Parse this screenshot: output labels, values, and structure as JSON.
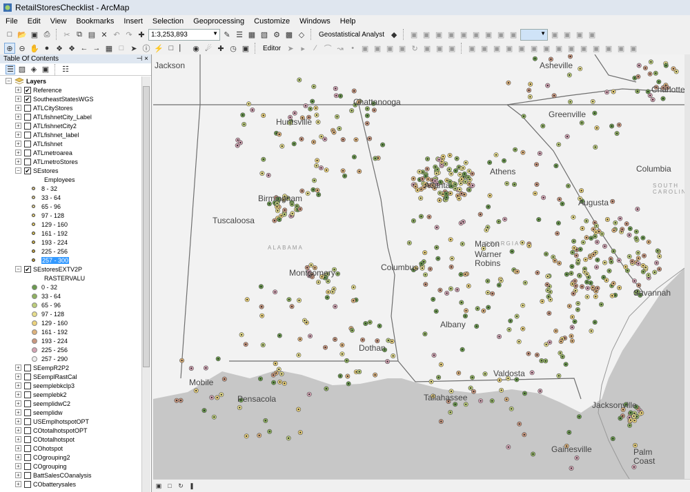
{
  "window": {
    "title": "RetailStoresChecklist - ArcMap"
  },
  "menu": [
    "File",
    "Edit",
    "View",
    "Bookmarks",
    "Insert",
    "Selection",
    "Geoprocessing",
    "Customize",
    "Windows",
    "Help"
  ],
  "toolbar": {
    "scale": "1:3,253,893",
    "geostat_label": "Geostatistical Analyst",
    "editor_label": "Editor"
  },
  "toc": {
    "title": "Table Of Contents",
    "pin": "⊣",
    "close": "×",
    "layers_label": "Layers",
    "layers": [
      {
        "name": "Reference",
        "checked": true
      },
      {
        "name": "SoutheastStatesWGS",
        "checked": true
      },
      {
        "name": "ATLCityStores",
        "checked": false
      },
      {
        "name": "ATLfishnetCity_Label",
        "checked": false
      },
      {
        "name": "ATLfishnetCity2",
        "checked": false
      },
      {
        "name": "ATLfishnet_label",
        "checked": false
      },
      {
        "name": "ATLfishnet",
        "checked": false
      },
      {
        "name": "ATLmetroarea",
        "checked": false
      },
      {
        "name": "ATLmetroStores",
        "checked": false
      }
    ],
    "sestores": {
      "name": "SEstores",
      "field": "Employees",
      "classes": [
        {
          "label": "8 - 32",
          "color": "#d8c38a"
        },
        {
          "label": "33 - 64",
          "color": "#dccb95"
        },
        {
          "label": "65 - 96",
          "color": "#e6d79a"
        },
        {
          "label": "97 - 128",
          "color": "#ecd683"
        },
        {
          "label": "129 - 160",
          "color": "#e9d06e"
        },
        {
          "label": "161 - 192",
          "color": "#d9c45c"
        },
        {
          "label": "193 - 224",
          "color": "#cdb24f"
        },
        {
          "label": "225 - 256",
          "color": "#c5a445"
        },
        {
          "label": "257 - 300",
          "color": "#b9983b",
          "selected": true
        }
      ]
    },
    "sestoresextv": {
      "name": "SEstoresEXTV2P",
      "field": "RASTERVALU",
      "classes": [
        {
          "label": "0 - 32",
          "color": "#6a9a4d"
        },
        {
          "label": "33 - 64",
          "color": "#8fb160"
        },
        {
          "label": "65 - 96",
          "color": "#bccd7b"
        },
        {
          "label": "97 - 128",
          "color": "#e6dd8c"
        },
        {
          "label": "129 - 160",
          "color": "#ecd37d"
        },
        {
          "label": "161 - 192",
          "color": "#ddb27c"
        },
        {
          "label": "193 - 224",
          "color": "#c9977f"
        },
        {
          "label": "225 - 256",
          "color": "#d4a4b4"
        },
        {
          "label": "257 - 290",
          "color": "#eeeeee"
        }
      ]
    },
    "more_layers": [
      {
        "name": "SEempR2P2",
        "checked": false
      },
      {
        "name": "SEemplRastCal",
        "checked": false
      },
      {
        "name": "seemplebkclp3",
        "checked": false
      },
      {
        "name": "seemplebk2",
        "checked": false
      },
      {
        "name": "seemplidwC2",
        "checked": false
      },
      {
        "name": "seemplidw",
        "checked": false
      },
      {
        "name": "USEmplhotspotOPT",
        "checked": false
      },
      {
        "name": "COtotalhotspotOPT",
        "checked": false
      },
      {
        "name": "COtotalhotspot",
        "checked": false
      },
      {
        "name": "COhotspot",
        "checked": false
      },
      {
        "name": "COgrouping2",
        "checked": false
      },
      {
        "name": "COgrouping",
        "checked": false
      },
      {
        "name": "BattSalesCOanalysis",
        "checked": false
      },
      {
        "name": "CObatterysales",
        "checked": false
      }
    ]
  },
  "map": {
    "states": [
      "ALABAMA",
      "GEORGIA",
      "SOUTH CAROLINA"
    ],
    "cities": [
      "Asheville",
      "Chattanooga",
      "Greenville",
      "Huntsville",
      "Athens",
      "Columbia",
      "Birmingham",
      "Atlanta",
      "Augusta",
      "Tuscaloosa",
      "Macon",
      "Warner Robins",
      "Columbus",
      "Montgomery",
      "Savannah",
      "Albany",
      "Dothan",
      "Valdosta",
      "Mobile",
      "Pensacola",
      "Tallahassee",
      "Jacksonville",
      "Gainesville",
      "Palm Coast",
      "Charlotte",
      "Jackson",
      "Jacksonville"
    ],
    "colors": {
      "background": "#eeeeee",
      "land": "#f2f2f2",
      "water": "#c7c7c7",
      "border": "#6e6e6e"
    }
  }
}
